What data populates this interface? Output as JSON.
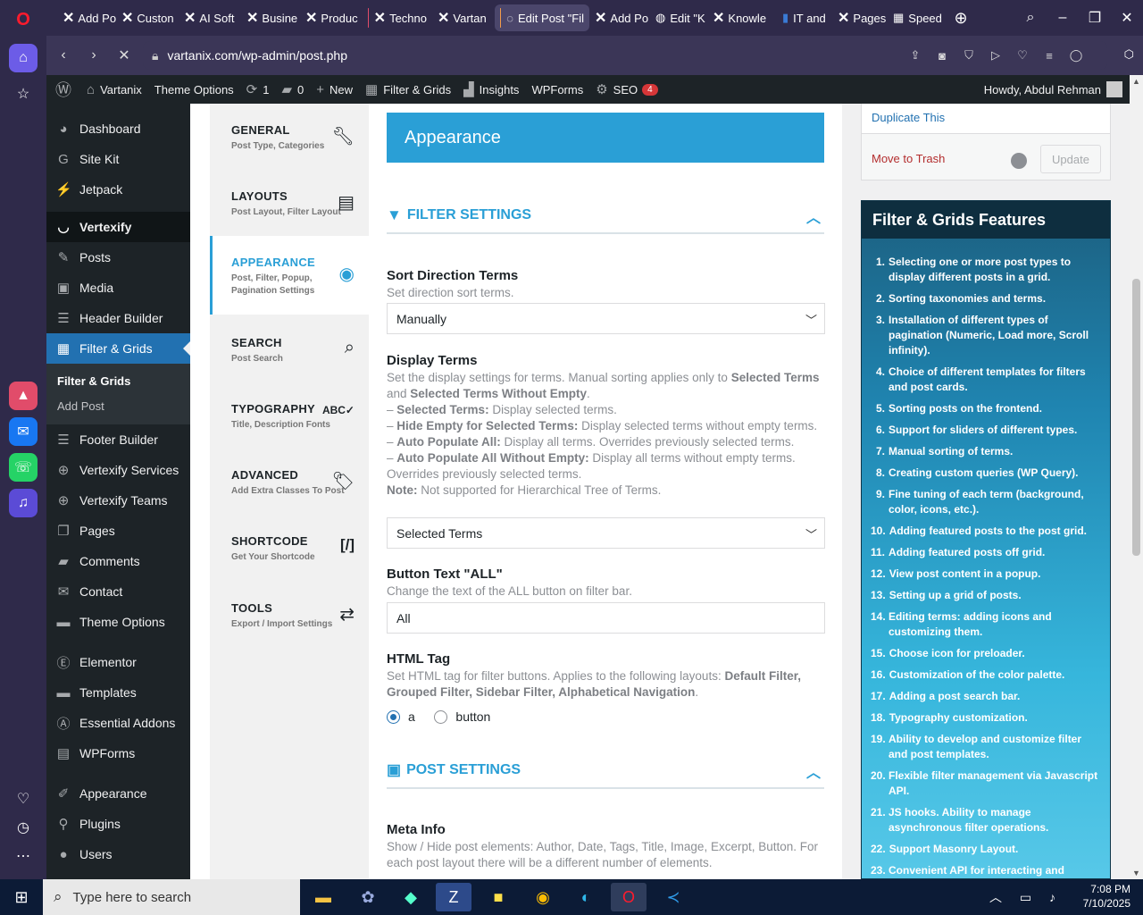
{
  "browser": {
    "tabs": [
      {
        "label": "Add Po",
        "icon": "x-icon"
      },
      {
        "label": "Custon",
        "icon": "x-icon"
      },
      {
        "label": "AI Soft",
        "icon": "x-icon"
      },
      {
        "label": "Busine",
        "icon": "x-icon"
      },
      {
        "label": "Produc",
        "icon": "x-icon"
      },
      {
        "label": "Techno",
        "icon": "x-icon"
      },
      {
        "label": "Vartan",
        "icon": "x-icon"
      },
      {
        "label": "Edit Post \"Fil",
        "icon": "loading-icon"
      },
      {
        "label": "Add Po",
        "icon": "x-icon"
      },
      {
        "label": "Edit \"K",
        "icon": "globe-icon"
      },
      {
        "label": "Knowle",
        "icon": "x-icon"
      },
      {
        "label": "IT and",
        "icon": "page-icon"
      },
      {
        "label": "Pages",
        "icon": "x-icon"
      },
      {
        "label": "Speed",
        "icon": "grid-icon"
      }
    ],
    "url": "vartanix.com/wp-admin/post.php"
  },
  "adminbar": {
    "site": "Vartanix",
    "theme_options": "Theme Options",
    "updates": "1",
    "comments": "0",
    "new": "New",
    "filter_grids": "Filter & Grids",
    "insights": "Insights",
    "wpforms": "WPForms",
    "seo": "SEO",
    "seo_count": "4",
    "howdy": "Howdy, Abdul Rehman"
  },
  "sidebar": {
    "items_top": [
      "Dashboard",
      "Site Kit",
      "Jetpack"
    ],
    "vertexify": "Vertexify",
    "items_mid": [
      "Posts",
      "Media",
      "Header Builder"
    ],
    "current": "Filter & Grids",
    "submenu": [
      "Filter & Grids",
      "Add Post"
    ],
    "items_bottom": [
      "Footer Builder",
      "Vertexify Services",
      "Vertexify Teams",
      "Pages",
      "Comments",
      "Contact",
      "Theme Options"
    ],
    "items_last": [
      "Elementor",
      "Templates",
      "Essential Addons",
      "WPForms"
    ],
    "items_end": [
      "Appearance",
      "Plugins",
      "Users"
    ]
  },
  "settings_nav": [
    {
      "title": "GENERAL",
      "desc": "Post Type, Categories"
    },
    {
      "title": "LAYOUTS",
      "desc": "Post Layout, Filter Layout"
    },
    {
      "title": "APPEARANCE",
      "desc": "Post, Filter, Popup, Pagination Settings"
    },
    {
      "title": "SEARCH",
      "desc": "Post Search"
    },
    {
      "title": "TYPOGRAPHY",
      "desc": "Title, Description Fonts"
    },
    {
      "title": "ADVANCED",
      "desc": "Add Extra Classes To Post"
    },
    {
      "title": "SHORTCODE",
      "desc": "Get Your Shortcode"
    },
    {
      "title": "TOOLS",
      "desc": "Export / Import Settings"
    }
  ],
  "main": {
    "header": "Appearance",
    "filter_section": "FILTER SETTINGS",
    "sort_label": "Sort Direction Terms",
    "sort_desc": "Set direction sort terms.",
    "sort_value": "Manually",
    "display_label": "Display Terms",
    "display_desc_1": "Set the display settings for terms. Manual sorting applies only to",
    "display_desc_b1": "Selected Terms",
    "display_desc_2": "and",
    "display_desc_b2": "Selected Terms Without Empty",
    "display_opt1_b": "Selected Terms:",
    "display_opt1": "Display selected terms.",
    "display_opt2_b": "Hide Empty for Selected Terms:",
    "display_opt2": "Display selected terms without empty terms.",
    "display_opt3_b": "Auto Populate All:",
    "display_opt3": "Display all terms. Overrides previously selected terms.",
    "display_opt4_b": "Auto Populate All Without Empty:",
    "display_opt4": "Display all terms without empty terms. Overrides previously selected terms.",
    "display_note_b": "Note:",
    "display_note": "Not supported for Hierarchical Tree of Terms.",
    "display_value": "Selected Terms",
    "btn_label": "Button Text \"ALL\"",
    "btn_desc": "Change the text of the ALL button on filter bar.",
    "btn_value": "All",
    "html_label": "HTML Tag",
    "html_desc_1": "Set HTML tag for filter buttons. Applies to the following layouts:",
    "html_desc_b": "Default Filter, Grouped Filter, Sidebar Filter, Alphabetical Navigation",
    "radio_a": "a",
    "radio_button": "button",
    "post_section": "POST SETTINGS",
    "meta_label": "Meta Info",
    "meta_desc": "Show / Hide post elements: Author, Date, Tags, Title, Image, Excerpt, Button. For each post layout there will be a different number of elements."
  },
  "publish": {
    "duplicate": "Duplicate This",
    "trash": "Move to Trash",
    "update": "Update"
  },
  "features": {
    "title": "Filter & Grids Features",
    "items": [
      "Selecting one or more post types to display different posts in a grid.",
      "Sorting taxonomies and terms.",
      "Installation of different types of pagination (Numeric, Load more, Scroll infinity).",
      "Choice of different templates for filters and post cards.",
      "Sorting posts on the frontend.",
      "Support for sliders of different types.",
      "Manual sorting of terms.",
      "Creating custom queries (WP Query).",
      "Fine tuning of each term (background, color, icons, etc.).",
      "Adding featured posts to the post grid.",
      "Adding featured posts off grid.",
      "View post content in a popup.",
      "Setting up a grid of posts.",
      "Editing terms: adding icons and customizing them.",
      "Choose icon for preloader.",
      "Customization of the color palette.",
      "Adding a post search bar.",
      "Typography customization.",
      "Ability to develop and customize filter and post templates.",
      "Flexible filter management via Javascript API.",
      "JS hooks. Ability to manage asynchronous filter operations.",
      "Support Masonry Layout.",
      "Convenient API for interacting and managing post filtering."
    ]
  },
  "taskbar": {
    "search_placeholder": "Type here to search",
    "time": "7:08 PM",
    "date": "7/10/2025"
  },
  "colors": {
    "accent": "#2a9fd6",
    "wp_dark": "#1d2327",
    "wp_blue": "#2271b1",
    "opera_bg": "#2f2a4a"
  }
}
